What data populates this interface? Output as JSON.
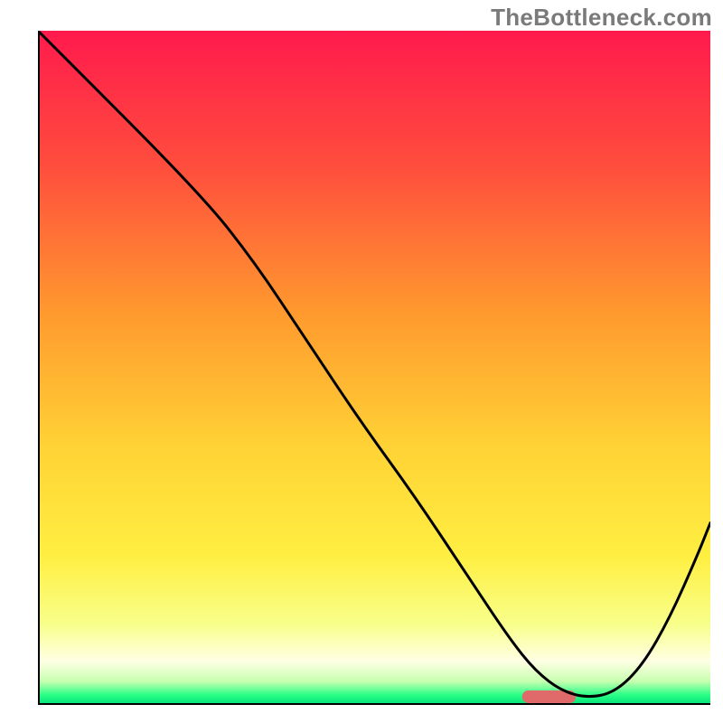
{
  "watermark": "TheBottleneck.com",
  "chart_data": {
    "type": "line",
    "title": "",
    "xlabel": "",
    "ylabel": "",
    "xlim": [
      0,
      100
    ],
    "ylim": [
      0,
      100
    ],
    "grid": false,
    "legend": false,
    "gradient_stops": [
      {
        "offset": 0,
        "color": "#ff1a4d"
      },
      {
        "offset": 0.2,
        "color": "#ff4d3d"
      },
      {
        "offset": 0.42,
        "color": "#ff9a2e"
      },
      {
        "offset": 0.62,
        "color": "#ffd335"
      },
      {
        "offset": 0.78,
        "color": "#ffef42"
      },
      {
        "offset": 0.88,
        "color": "#f8ff8a"
      },
      {
        "offset": 0.935,
        "color": "#ffffe4"
      },
      {
        "offset": 0.965,
        "color": "#c7ffb0"
      },
      {
        "offset": 0.985,
        "color": "#2bff86"
      },
      {
        "offset": 1.0,
        "color": "#00e07a"
      }
    ],
    "series": [
      {
        "name": "bottleneck-curve",
        "x": [
          0,
          24,
          32,
          40,
          48,
          56,
          64,
          70,
          74,
          78,
          82,
          86,
          90,
          94,
          98,
          100
        ],
        "y": [
          100,
          76,
          66,
          54,
          42,
          31,
          19,
          10,
          5,
          2,
          1,
          2,
          6,
          13,
          22,
          27
        ]
      }
    ],
    "marker": {
      "name": "highlight-pill",
      "x_center": 76,
      "y": 1.2,
      "width_pct": 8,
      "color": "#e06a6a"
    }
  }
}
